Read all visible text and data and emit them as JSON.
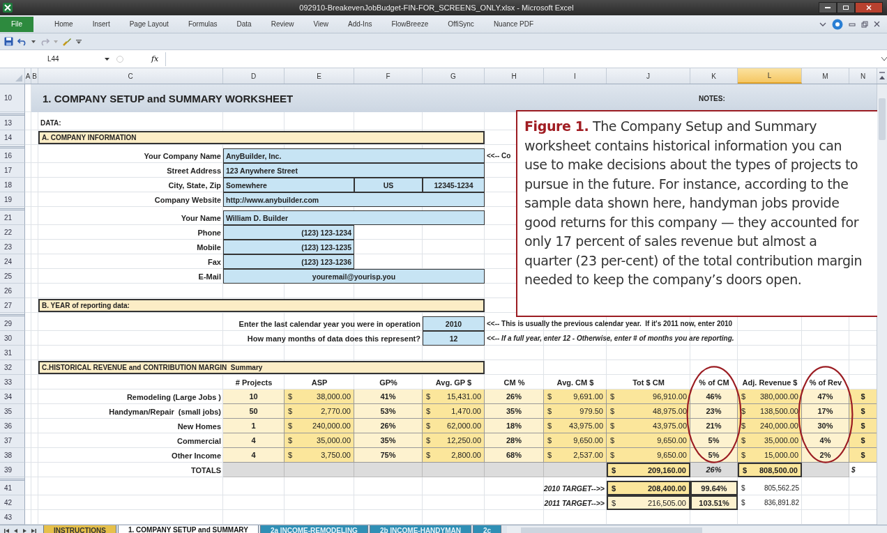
{
  "window": {
    "title": "092910-BreakevenJobBudget-FIN-FOR_SCREENS_ONLY.xlsx - Microsoft Excel"
  },
  "ribbon_tabs": [
    {
      "label": "File",
      "kind": "file"
    },
    {
      "label": "Home",
      "kind": "tab"
    },
    {
      "label": "Insert",
      "kind": "tab"
    },
    {
      "label": "Page Layout",
      "kind": "tab"
    },
    {
      "label": "Formulas",
      "kind": "tab"
    },
    {
      "label": "Data",
      "kind": "tab"
    },
    {
      "label": "Review",
      "kind": "tab"
    },
    {
      "label": "View",
      "kind": "tab"
    },
    {
      "label": "Add-Ins",
      "kind": "tab"
    },
    {
      "label": "FlowBreeze",
      "kind": "tab"
    },
    {
      "label": "OffiSync",
      "kind": "tab"
    },
    {
      "label": "Nuance PDF",
      "kind": "tab"
    }
  ],
  "formula_bar": {
    "name_box": "L44",
    "fx_label": "fx"
  },
  "columns": [
    {
      "label": "A",
      "selected": false
    },
    {
      "label": "B",
      "selected": false
    },
    {
      "label": "C",
      "selected": false
    },
    {
      "label": "D",
      "selected": false
    },
    {
      "label": "E",
      "selected": false
    },
    {
      "label": "F",
      "selected": false
    },
    {
      "label": "G",
      "selected": false
    },
    {
      "label": "H",
      "selected": false
    },
    {
      "label": "I",
      "selected": false
    },
    {
      "label": "J",
      "selected": false
    },
    {
      "label": "K",
      "selected": false,
      "circled": true
    },
    {
      "label": "L",
      "selected": true
    },
    {
      "label": "M",
      "selected": false,
      "circled": true
    },
    {
      "label": "N",
      "selected": false
    }
  ],
  "rows": [
    {
      "number": "10",
      "B": {
        "kind": "band",
        "text": "1. COMPANY SETUP and SUMMARY WORKSHEET"
      },
      "C": {
        "kind": "merge"
      },
      "D": {
        "kind": "merge"
      },
      "E": {
        "kind": "merge"
      },
      "F": {
        "kind": "merge"
      },
      "G": {
        "kind": "merge"
      },
      "H": {
        "kind": "merge"
      },
      "I": {
        "kind": "merge"
      },
      "J": {
        "kind": "merge"
      },
      "K": {
        "kind": "band-note",
        "text": "NOTES:"
      },
      "L": {
        "kind": "merge"
      },
      "M": {
        "kind": "merge"
      },
      "N": {
        "kind": "merge"
      }
    },
    {
      "number": "13",
      "C": {
        "kind": "plain",
        "text": "DATA:"
      }
    },
    {
      "number": "14",
      "C": {
        "kind": "section",
        "text": "A. COMPANY INFORMATION"
      },
      "D": {
        "kind": "merge"
      },
      "E": {
        "kind": "merge"
      },
      "F": {
        "kind": "merge"
      },
      "G": {
        "kind": "merge"
      }
    },
    {
      "number": "16",
      "C": {
        "kind": "label",
        "text": "Your Company Name"
      },
      "D": {
        "kind": "input-left",
        "text": "AnyBuilder, Inc."
      },
      "E": {
        "kind": "merge"
      },
      "F": {
        "kind": "merge"
      },
      "G": {
        "kind": "merge"
      },
      "H": {
        "kind": "note",
        "text": "<<-- Co"
      }
    },
    {
      "number": "17",
      "C": {
        "kind": "label",
        "text": "Street Address"
      },
      "D": {
        "kind": "input-left",
        "text": "123 Anywhere Street"
      },
      "E": {
        "kind": "merge"
      },
      "F": {
        "kind": "merge"
      },
      "G": {
        "kind": "merge"
      }
    },
    {
      "number": "18",
      "C": {
        "kind": "label",
        "text": "City, State, Zip"
      },
      "D": {
        "kind": "input-left",
        "text": "Somewhere"
      },
      "E": {
        "kind": "merge"
      },
      "F": {
        "kind": "input-center",
        "text": "US"
      },
      "G": {
        "kind": "input-center",
        "text": "12345-1234"
      }
    },
    {
      "number": "19",
      "C": {
        "kind": "label",
        "text": "Company Website"
      },
      "D": {
        "kind": "input-left",
        "text": "http://www.anybuilder.com"
      },
      "E": {
        "kind": "merge"
      },
      "F": {
        "kind": "merge"
      },
      "G": {
        "kind": "merge"
      }
    },
    {
      "number": "21",
      "C": {
        "kind": "label",
        "text": "Your Name"
      },
      "D": {
        "kind": "input-left",
        "text": "William D. Builder"
      },
      "E": {
        "kind": "merge"
      },
      "F": {
        "kind": "merge"
      },
      "G": {
        "kind": "merge"
      }
    },
    {
      "number": "22",
      "C": {
        "kind": "label",
        "text": "Phone"
      },
      "D": {
        "kind": "input-right",
        "text": "(123) 123-1234"
      },
      "E": {
        "kind": "merge"
      }
    },
    {
      "number": "23",
      "C": {
        "kind": "label",
        "text": "Mobile"
      },
      "D": {
        "kind": "input-right",
        "text": "(123) 123-1235"
      },
      "E": {
        "kind": "merge"
      }
    },
    {
      "number": "24",
      "C": {
        "kind": "label",
        "text": "Fax"
      },
      "D": {
        "kind": "input-right",
        "text": "(123) 123-1236"
      },
      "E": {
        "kind": "merge"
      }
    },
    {
      "number": "25",
      "C": {
        "kind": "label",
        "text": "E-Mail"
      },
      "D": {
        "kind": "input-center",
        "text": "youremail@yourisp.you"
      },
      "E": {
        "kind": "merge"
      },
      "F": {
        "kind": "merge"
      },
      "G": {
        "kind": "merge"
      }
    },
    {
      "number": "26"
    },
    {
      "number": "27",
      "C": {
        "kind": "section",
        "text": "B. YEAR of reporting data:"
      },
      "D": {
        "kind": "merge"
      },
      "E": {
        "kind": "merge"
      },
      "F": {
        "kind": "merge"
      },
      "G": {
        "kind": "merge"
      }
    },
    {
      "number": "29",
      "C": {
        "kind": "label",
        "text": "Enter the last calendar year you were in operation"
      },
      "D": {
        "kind": "merge"
      },
      "E": {
        "kind": "merge"
      },
      "F": {
        "kind": "merge"
      },
      "G": {
        "kind": "input-center",
        "text": "2010"
      },
      "H": {
        "kind": "note",
        "text": "<<-- This is usually the previous calendar year.  If it's 2011 now, enter 2010"
      },
      "I": {
        "kind": "merge"
      },
      "J": {
        "kind": "merge"
      },
      "K": {
        "kind": "merge"
      },
      "L": {
        "kind": "merge"
      },
      "M": {
        "kind": "merge"
      }
    },
    {
      "number": "30",
      "C": {
        "kind": "label",
        "text": "How many months of data does this represent?"
      },
      "D": {
        "kind": "merge"
      },
      "E": {
        "kind": "merge"
      },
      "F": {
        "kind": "merge"
      },
      "G": {
        "kind": "input-center",
        "text": "12"
      },
      "H": {
        "kind": "hint",
        "text": "<<-- If a full year, enter 12 - Otherwise, enter # of months you are reporting."
      },
      "I": {
        "kind": "merge"
      },
      "J": {
        "kind": "merge"
      },
      "K": {
        "kind": "merge"
      },
      "L": {
        "kind": "merge"
      },
      "M": {
        "kind": "merge"
      }
    },
    {
      "number": "31"
    },
    {
      "number": "32",
      "C": {
        "kind": "section",
        "text": "C.HISTORICAL REVENUE and CONTRIBUTION MARGIN  Summary"
      },
      "D": {
        "kind": "merge"
      },
      "E": {
        "kind": "merge"
      },
      "F": {
        "kind": "merge"
      },
      "G": {
        "kind": "merge"
      }
    },
    {
      "number": "33",
      "D": {
        "kind": "head",
        "text": "# Projects"
      },
      "E": {
        "kind": "head",
        "text": "ASP"
      },
      "F": {
        "kind": "head",
        "text": "GP%"
      },
      "G": {
        "kind": "head",
        "text": "Avg. GP $"
      },
      "H": {
        "kind": "head",
        "text": "CM %"
      },
      "I": {
        "kind": "head",
        "text": "Avg. CM $"
      },
      "J": {
        "kind": "head",
        "text": "Tot $ CM"
      },
      "K": {
        "kind": "head",
        "text": "% of CM"
      },
      "L": {
        "kind": "head",
        "text": "Adj. Revenue $"
      },
      "M": {
        "kind": "head",
        "text": "% of Rev"
      }
    },
    {
      "number": "34",
      "C": {
        "kind": "label",
        "text": "Remodeling (Large Jobs )"
      },
      "D": {
        "kind": "cream",
        "text": "10"
      },
      "E": {
        "kind": "yellow",
        "currency": "$",
        "amount": "38,000.00"
      },
      "F": {
        "kind": "cream",
        "text": "41%"
      },
      "G": {
        "kind": "yellow",
        "currency": "$",
        "amount": "15,431.00"
      },
      "H": {
        "kind": "cream",
        "text": "26%"
      },
      "I": {
        "kind": "yellow",
        "currency": "$",
        "amount": "9,691.00"
      },
      "J": {
        "kind": "yellow",
        "currency": "$",
        "amount": "96,910.00"
      },
      "K": {
        "kind": "cream",
        "text": "46%"
      },
      "L": {
        "kind": "yellow",
        "currency": "$",
        "amount": "380,000.00"
      },
      "M": {
        "kind": "cream",
        "text": "47%"
      },
      "N": {
        "kind": "yellow",
        "text": "$"
      }
    },
    {
      "number": "35",
      "C": {
        "kind": "label",
        "text": "Handyman/Repair  (small jobs)"
      },
      "D": {
        "kind": "cream",
        "text": "50"
      },
      "E": {
        "kind": "yellow",
        "currency": "$",
        "amount": "2,770.00"
      },
      "F": {
        "kind": "cream",
        "text": "53%"
      },
      "G": {
        "kind": "yellow",
        "currency": "$",
        "amount": "1,470.00"
      },
      "H": {
        "kind": "cream",
        "text": "35%"
      },
      "I": {
        "kind": "yellow",
        "currency": "$",
        "amount": "979.50"
      },
      "J": {
        "kind": "yellow",
        "currency": "$",
        "amount": "48,975.00"
      },
      "K": {
        "kind": "cream",
        "text": "23%"
      },
      "L": {
        "kind": "yellow",
        "currency": "$",
        "amount": "138,500.00"
      },
      "M": {
        "kind": "cream",
        "text": "17%"
      },
      "N": {
        "kind": "yellow",
        "text": "$"
      }
    },
    {
      "number": "36",
      "C": {
        "kind": "label",
        "text": "New Homes"
      },
      "D": {
        "kind": "cream",
        "text": "1"
      },
      "E": {
        "kind": "yellow",
        "currency": "$",
        "amount": "240,000.00"
      },
      "F": {
        "kind": "cream",
        "text": "26%"
      },
      "G": {
        "kind": "yellow",
        "currency": "$",
        "amount": "62,000.00"
      },
      "H": {
        "kind": "cream",
        "text": "18%"
      },
      "I": {
        "kind": "yellow",
        "currency": "$",
        "amount": "43,975.00"
      },
      "J": {
        "kind": "yellow",
        "currency": "$",
        "amount": "43,975.00"
      },
      "K": {
        "kind": "cream",
        "text": "21%"
      },
      "L": {
        "kind": "yellow",
        "currency": "$",
        "amount": "240,000.00"
      },
      "M": {
        "kind": "cream",
        "text": "30%"
      },
      "N": {
        "kind": "yellow",
        "text": "$"
      }
    },
    {
      "number": "37",
      "C": {
        "kind": "label",
        "text": "Commercial"
      },
      "D": {
        "kind": "cream",
        "text": "4"
      },
      "E": {
        "kind": "yellow",
        "currency": "$",
        "amount": "35,000.00"
      },
      "F": {
        "kind": "cream",
        "text": "35%"
      },
      "G": {
        "kind": "yellow",
        "currency": "$",
        "amount": "12,250.00"
      },
      "H": {
        "kind": "cream",
        "text": "28%"
      },
      "I": {
        "kind": "yellow",
        "currency": "$",
        "amount": "9,650.00"
      },
      "J": {
        "kind": "yellow",
        "currency": "$",
        "amount": "9,650.00"
      },
      "K": {
        "kind": "cream",
        "text": "5%"
      },
      "L": {
        "kind": "yellow",
        "currency": "$",
        "amount": "35,000.00"
      },
      "M": {
        "kind": "cream",
        "text": "4%"
      },
      "N": {
        "kind": "yellow",
        "text": "$"
      }
    },
    {
      "number": "38",
      "C": {
        "kind": "label",
        "text": "Other Income"
      },
      "D": {
        "kind": "cream",
        "text": "4"
      },
      "E": {
        "kind": "yellow",
        "currency": "$",
        "amount": "3,750.00"
      },
      "F": {
        "kind": "cream",
        "text": "75%"
      },
      "G": {
        "kind": "yellow",
        "currency": "$",
        "amount": "2,800.00"
      },
      "H": {
        "kind": "cream",
        "text": "68%"
      },
      "I": {
        "kind": "yellow",
        "currency": "$",
        "amount": "2,537.00"
      },
      "J": {
        "kind": "yellow",
        "currency": "$",
        "amount": "9,650.00"
      },
      "K": {
        "kind": "cream",
        "text": "5%"
      },
      "L": {
        "kind": "yellow",
        "currency": "$",
        "amount": "15,000.00"
      },
      "M": {
        "kind": "cream",
        "text": "2%"
      },
      "N": {
        "kind": "yellow",
        "text": "$"
      }
    },
    {
      "number": "39",
      "C": {
        "kind": "label",
        "text": "TOTALS"
      },
      "D": {
        "kind": "gray"
      },
      "E": {
        "kind": "gray"
      },
      "F": {
        "kind": "gray"
      },
      "G": {
        "kind": "gray"
      },
      "H": {
        "kind": "gray"
      },
      "I": {
        "kind": "gray"
      },
      "J": {
        "kind": "total",
        "currency": "$",
        "amount": "209,160.00"
      },
      "K": {
        "kind": "gray",
        "text": "26%"
      },
      "L": {
        "kind": "total",
        "currency": "$",
        "amount": "808,500.00"
      },
      "M": {
        "kind": "gray"
      },
      "N": {
        "kind": "hint",
        "text": "$"
      }
    },
    {
      "number": "41",
      "H": {
        "kind": "target",
        "text": "2010 TARGET-->>"
      },
      "I": {
        "kind": "merge"
      },
      "J": {
        "kind": "total",
        "currency": "$",
        "amount": "208,400.00"
      },
      "K": {
        "kind": "total-cream",
        "text": "99.64%"
      },
      "L": {
        "kind": "plain",
        "currency": "$",
        "amount": "805,562.25"
      }
    },
    {
      "number": "42",
      "H": {
        "kind": "target",
        "text": "2011 TARGET-->>"
      },
      "I": {
        "kind": "merge"
      },
      "J": {
        "kind": "total-cream",
        "currency": "$",
        "amount": "216,505.00"
      },
      "K": {
        "kind": "total-cream",
        "text": "103.51%"
      },
      "L": {
        "kind": "plain",
        "currency": "$",
        "amount": "836,891.82"
      }
    },
    {
      "number": "43"
    }
  ],
  "caption": {
    "text": "**Figure 1.** The Company Setup and Summary worksheet contains historical information you can use to make decisions about the types of projects to pursue in the future. For instance, according to the sample data shown here, handyman jobs provide good returns for this company — they accounted for only 17 percent of sales revenue but almost a quarter (23 per-cent) of the total contribution margin needed to keep the company’s doors open."
  },
  "sheet_tabs": [
    {
      "label": "INSTRUCTIONS",
      "selected": false,
      "color": "#e6c04a"
    },
    {
      "label": "1. COMPANY SETUP and SUMMARY",
      "selected": true,
      "color": "#ffffff"
    },
    {
      "label": "2a INCOME-REMODELING",
      "selected": false,
      "color": "#2f8fb5"
    },
    {
      "label": "2b INCOME-HANDYMAN",
      "selected": false,
      "color": "#2f8fb5"
    },
    {
      "label": "2c",
      "selected": false,
      "color": "#2f8fb5"
    }
  ]
}
